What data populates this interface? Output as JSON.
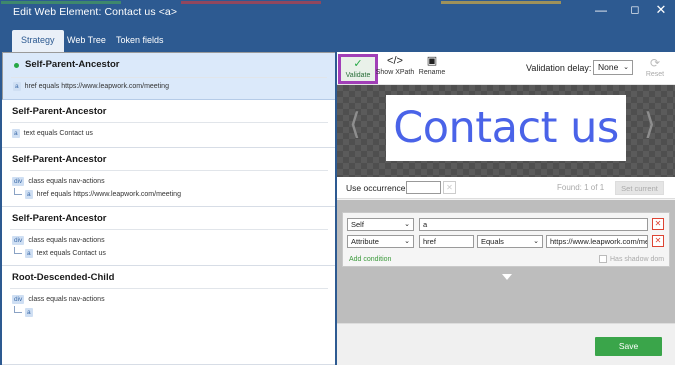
{
  "window": {
    "title": "Edit Web Element:  Contact us <a>",
    "top_strip_colors": [
      "#4caf50",
      "#e53935",
      "#fbc02d"
    ]
  },
  "tabs": [
    {
      "label": "Strategy",
      "active": true
    },
    {
      "label": "Web Tree",
      "active": false
    },
    {
      "label": "Token fields",
      "active": false
    }
  ],
  "strategies": [
    {
      "title": "Self-Parent-Ancestor",
      "selected": true,
      "rows": [
        {
          "tag": "a",
          "text": "href equals https://www.leapwork.com/meeting"
        }
      ]
    },
    {
      "title": "Self-Parent-Ancestor",
      "selected": false,
      "rows": [
        {
          "tag": "a",
          "text": "text equals Contact us"
        }
      ]
    },
    {
      "title": "Self-Parent-Ancestor",
      "selected": false,
      "rows": [
        {
          "tag": "div",
          "text": "class equals nav-actions"
        },
        {
          "tag": "a",
          "text": "href equals https://www.leapwork.com/meeting"
        }
      ]
    },
    {
      "title": "Self-Parent-Ancestor",
      "selected": false,
      "rows": [
        {
          "tag": "div",
          "text": "class equals nav-actions"
        },
        {
          "tag": "a",
          "text": "text equals Contact us"
        }
      ]
    },
    {
      "title": "Root-Descended-Child",
      "selected": false,
      "rows": [
        {
          "tag": "div",
          "text": "class equals nav-actions"
        },
        {
          "tag": "a",
          "text": ""
        }
      ]
    }
  ],
  "toolbar": {
    "validate": "Validate",
    "show_xpath": "Show XPath",
    "rename": "Rename",
    "validation_delay_label": "Validation delay:",
    "validation_delay_value": "None",
    "reset": "Reset"
  },
  "preview": {
    "text": "Contact us"
  },
  "occurrence": {
    "label": "Use occurrence:",
    "value": "",
    "found": "Found:  1 of 1",
    "set_current": "Set current"
  },
  "conditions": [
    {
      "type": "Self",
      "value": "a"
    },
    {
      "type": "Attribute",
      "attribute": "href",
      "operator": "Equals",
      "value": "https://www.leapwork.com/meeting"
    }
  ],
  "add_condition": "Add condition",
  "has_shadow_dom": "Has shadow dom",
  "save": "Save"
}
